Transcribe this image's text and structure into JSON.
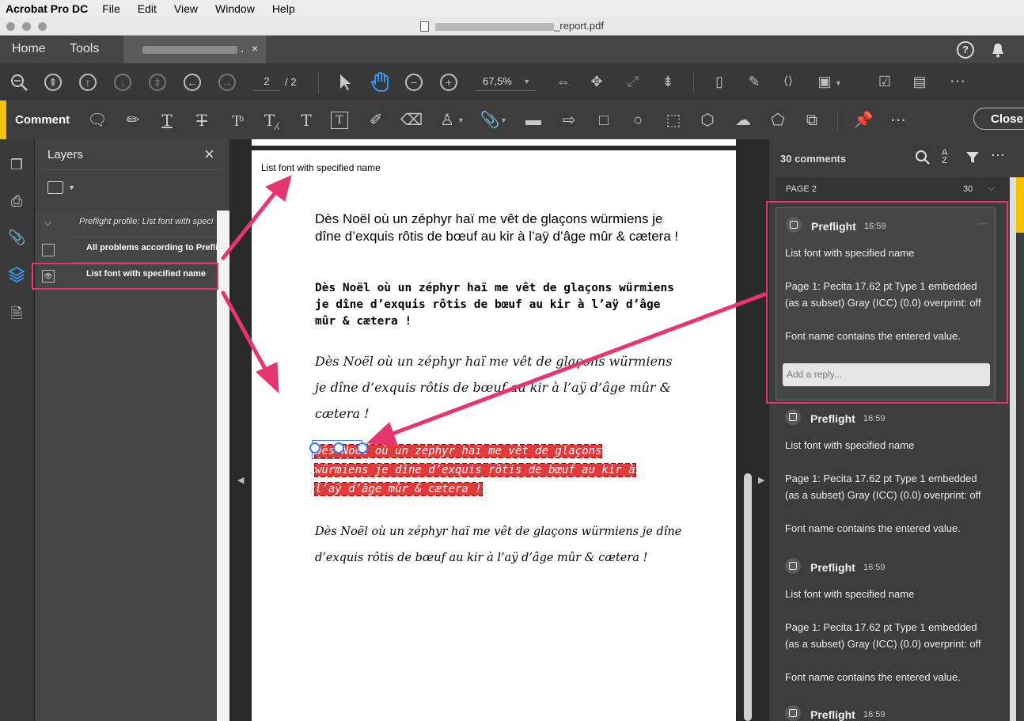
{
  "menubar": {
    "app": "Acrobat Pro DC",
    "items": [
      "File",
      "Edit",
      "View",
      "Window",
      "Help"
    ]
  },
  "titlebar": {
    "filename_suffix": "_report.pdf"
  },
  "tabs": {
    "home": "Home",
    "tools": "Tools",
    "doc_tab_suffix": "."
  },
  "toolbar": {
    "page_current": "2",
    "page_total": "/ 2",
    "zoom": "67,5%"
  },
  "comment_toolbar": {
    "label": "Comment",
    "close": "Close"
  },
  "layers": {
    "title": "Layers",
    "items": [
      "Preflight profile: List font with speci",
      "All problems according to Prefli",
      "List font with specified name"
    ]
  },
  "document": {
    "header": "List font with specified name",
    "paragraphs": [
      "Dès Noël où un zéphyr haï me vêt de glaçons würmiens je dîne d’exquis rôtis de bœuf au kir à l’aÿ d’âge mûr & cætera !",
      "Dès Noël où un zéphyr haï me vêt de glaçons würmiens je dîne d’exquis rôtis de bœuf au kir à l’aÿ d’âge mûr & cætera !",
      "Dès Noël où un zéphyr haï me vêt de glaçons würmiens je dîne d’exquis rôtis de bœuf au kir à l’aÿ d’âge mûr & cætera !",
      "Dès Noël où un zéphyr haï me vêt de glaçons würmiens je dîne d’exquis rôtis de bœuf au kir à l’aÿ d’âge mûr & cætera !",
      "Dès Noël où un zéphyr haï me vêt de glaçons würmiens je dîne d’exquis rôtis de bœuf au kir à l’aÿ d’âge mûr & cætera !"
    ]
  },
  "comments": {
    "count": "30 comments",
    "page_label": "PAGE 2",
    "page_count": "30",
    "reply_placeholder": "Add a reply...",
    "items": [
      {
        "author": "Preflight",
        "time": "16:59",
        "title": "List font with specified name",
        "detail1": "Page 1: Pecita 17.62 pt Type 1  embedded",
        "detail2": "(as a subset) Gray (ICC) (0.0)  overprint: off",
        "note": "Font name contains the entered value."
      },
      {
        "author": "Preflight",
        "time": "16:59",
        "title": "List font with specified name",
        "detail1": "Page 1: Pecita 17.62 pt Type 1  embedded",
        "detail2": "(as a subset) Gray (ICC) (0.0)  overprint: off",
        "note": "Font name contains the entered value."
      },
      {
        "author": "Preflight",
        "time": "16:59",
        "title": "List font with specified name",
        "detail1": "Page 1: Pecita 17.62 pt Type 1  embedded",
        "detail2": "(as a subset) Gray (ICC) (0.0)  overprint: off",
        "note": "Font name contains the entered value."
      },
      {
        "author": "Preflight",
        "time": "16:59"
      }
    ]
  },
  "colors": {
    "accent_pink": "#e8356f",
    "comment_yellow": "#f5c400",
    "highlight_red": "#e23a3a"
  }
}
